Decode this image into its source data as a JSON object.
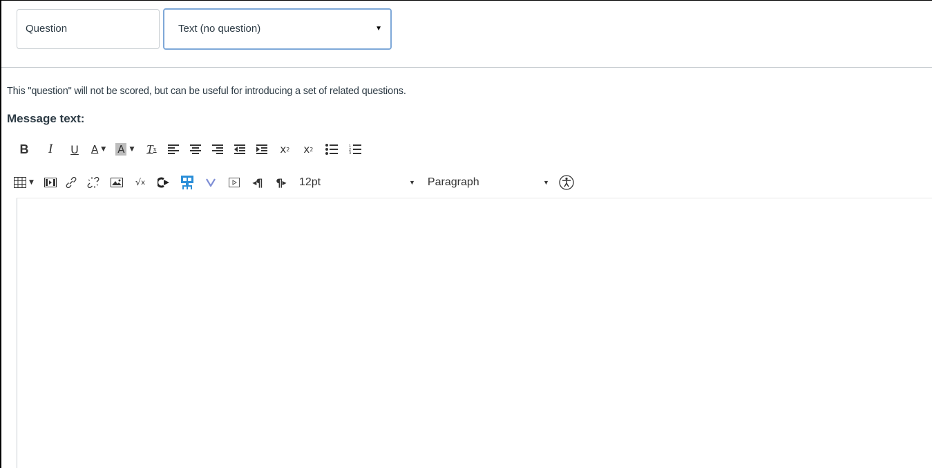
{
  "header": {
    "question_name": "Question",
    "question_type": "Text (no question)"
  },
  "helper_text": "This \"question\" will not be scored, but can be useful for introducing a set of related questions.",
  "message_label": "Message text:",
  "toolbar": {
    "font_size": "12pt",
    "block_format": "Paragraph",
    "row1_icons": [
      "bold-icon",
      "italic-icon",
      "underline-icon",
      "text-color-icon",
      "background-color-icon",
      "clear-formatting-icon",
      "align-left-icon",
      "align-center-icon",
      "align-right-icon",
      "outdent-icon",
      "indent-icon",
      "superscript-icon",
      "subscript-icon",
      "bullet-list-icon",
      "numbered-list-icon"
    ],
    "row2_icons": [
      "table-icon",
      "media-icon",
      "link-icon",
      "unlink-icon",
      "image-icon",
      "equation-icon",
      "lti-tool-icon",
      "apps-icon",
      "vimeo-icon",
      "video-icon",
      "ltr-icon",
      "rtl-icon",
      "accessibility-icon"
    ]
  },
  "colors": {
    "text": "#2d3b45",
    "border": "#c7cdd1",
    "focus_border": "#7ea8d8",
    "apps_icon": "#2a8ed8",
    "vimeo_icon": "#7f8fd6"
  }
}
